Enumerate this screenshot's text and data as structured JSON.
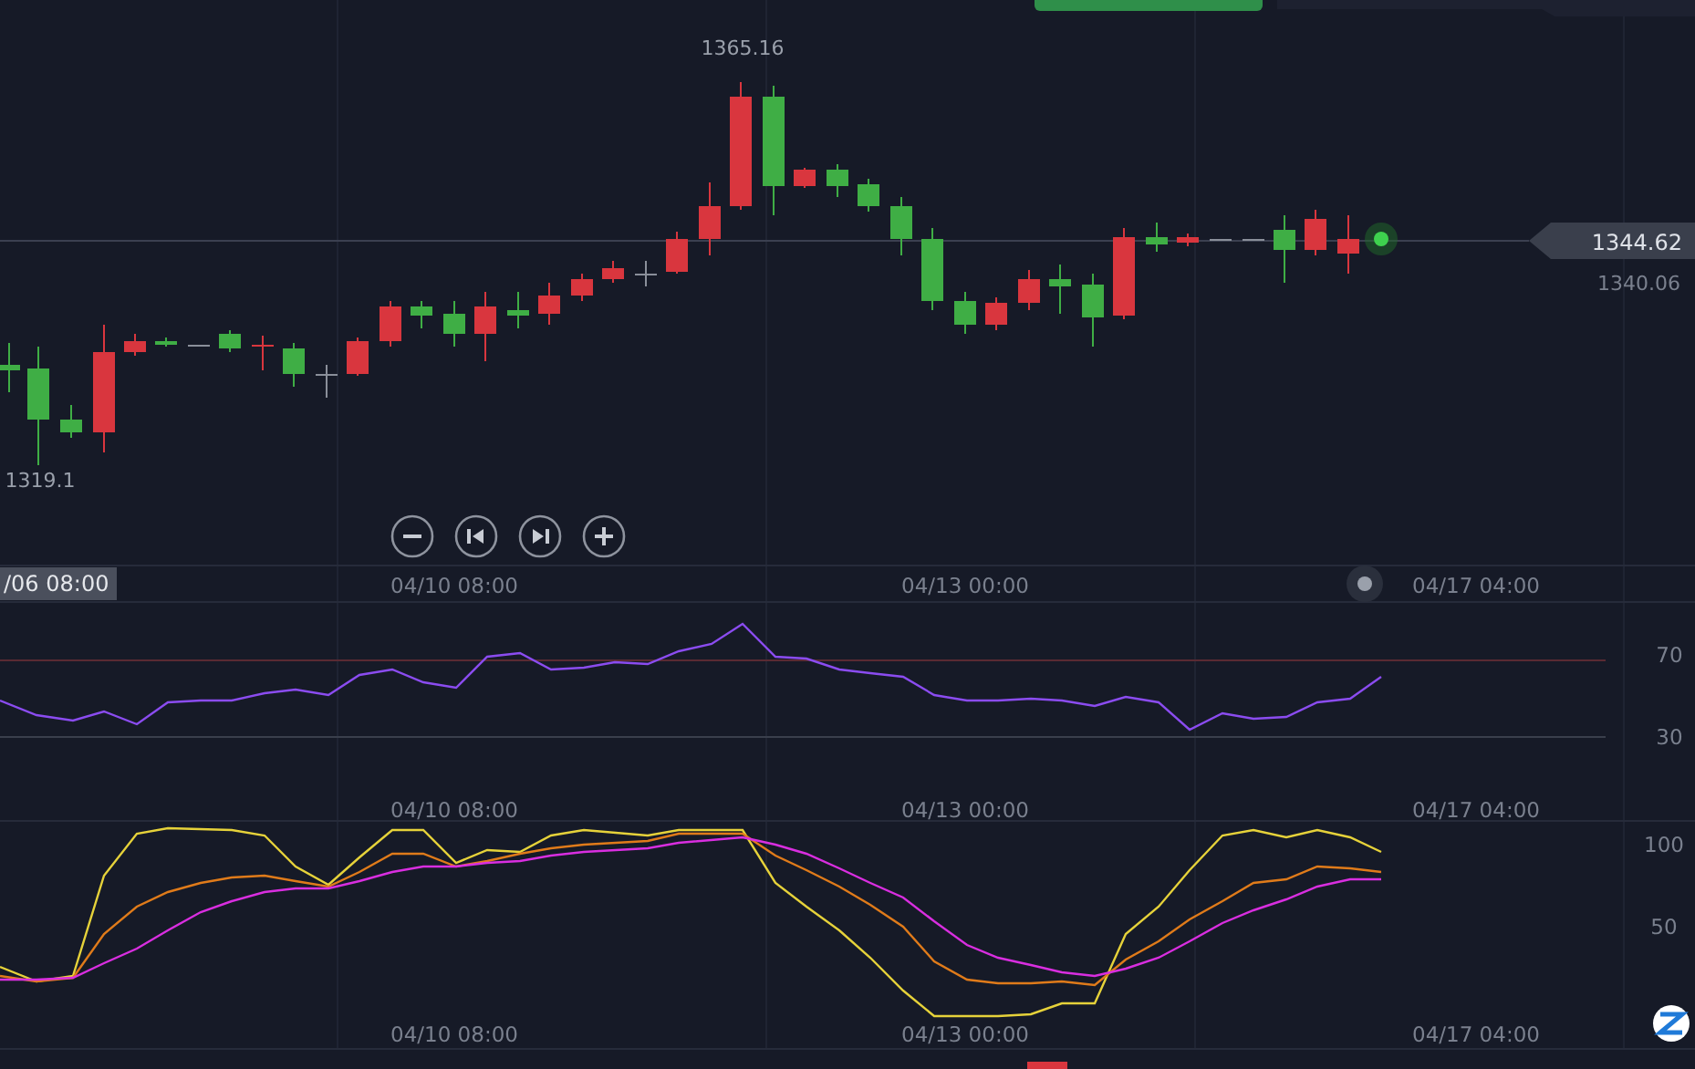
{
  "price_pane": {
    "high_label": "1365.16",
    "low_label": "1319.1",
    "current_price": "1344.62",
    "reference_price": "1340.06"
  },
  "time_axes": [
    {
      "cursor_label": "/06 08:00",
      "labels": [
        "04/10 08:00",
        "04/13 00:00",
        "04/17 04:00"
      ]
    },
    {
      "labels": [
        "04/10 08:00",
        "04/13 00:00",
        "04/17 04:00"
      ]
    },
    {
      "labels": [
        "04/10 08:00",
        "04/13 00:00",
        "04/17 04:00"
      ]
    }
  ],
  "rsi_pane": {
    "levels": [
      "70",
      "30"
    ]
  },
  "kdj_pane": {
    "levels": [
      "100",
      "50"
    ]
  }
}
